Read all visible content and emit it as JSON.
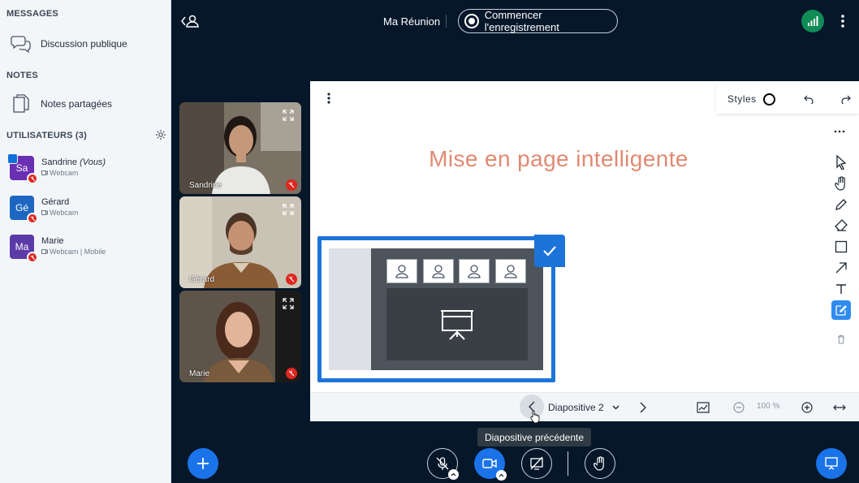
{
  "sidebar": {
    "messages_title": "MESSAGES",
    "public_chat": "Discussion publique",
    "notes_title": "NOTES",
    "shared_notes": "Notes partagées",
    "users_title": "UTILISATEURS (3)",
    "users": [
      {
        "initials": "Sa",
        "name": "Sandrine",
        "you_suffix": "(Vous)",
        "device": "Webcam",
        "color": "#6b2fb3"
      },
      {
        "initials": "Gé",
        "name": "Gérard",
        "device": "Webcam",
        "color": "#1d67c2"
      },
      {
        "initials": "Ma",
        "name": "Marie",
        "device": "Webcam | Mobile",
        "color": "#5b3ba8"
      }
    ]
  },
  "topbar": {
    "meeting_title": "Ma Réunion",
    "record_label": "Commencer l'enregistrement"
  },
  "videos": [
    {
      "name": "Sandrine"
    },
    {
      "name": "Gérard"
    },
    {
      "name": "Marie"
    }
  ],
  "presentation": {
    "styles_label": "Styles",
    "slide_title": "Mise en page intelligente",
    "current_slide": "Diapositive 2",
    "zoom": "100 %",
    "tooltip": "Diapositive précédente"
  },
  "colors": {
    "accent": "#1a73e8",
    "title_coral": "#e08a72",
    "mute_red": "#df2721",
    "connection_green": "#108c57"
  }
}
